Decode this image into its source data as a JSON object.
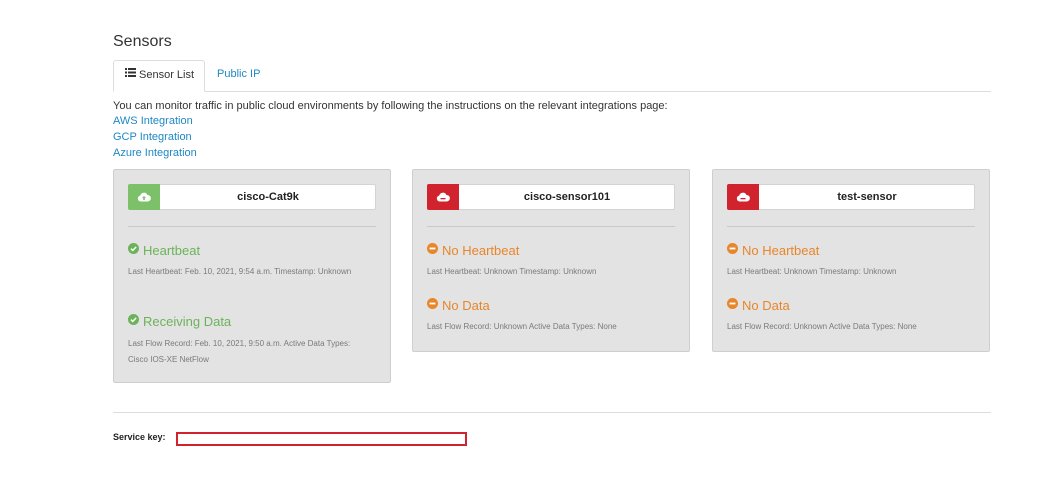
{
  "header": {
    "title": "Sensors"
  },
  "tabs": [
    {
      "label": "Sensor List",
      "icon": "list-icon",
      "active": true
    },
    {
      "label": "Public IP",
      "active": false
    }
  ],
  "intro": {
    "text": "You can monitor traffic in public cloud environments by following the instructions on the relevant integrations page:",
    "links": [
      "AWS Integration",
      "GCP Integration",
      "Azure Integration"
    ]
  },
  "sensors": [
    {
      "name": "cisco-Cat9k",
      "cloud_color": "#7cc06a",
      "heartbeat": {
        "label": "Heartbeat",
        "state": "ok",
        "detail": "Last Heartbeat: Feb. 10, 2021, 9:54 a.m. Timestamp: Unknown"
      },
      "data": {
        "label": "Receiving Data",
        "state": "ok",
        "detail": "Last Flow Record: Feb. 10, 2021, 9:50 a.m. Active Data Types: Cisco IOS-XE NetFlow"
      }
    },
    {
      "name": "cisco-sensor101",
      "cloud_color": "#d0232e",
      "heartbeat": {
        "label": "No Heartbeat",
        "state": "warn",
        "detail": "Last Heartbeat: Unknown Timestamp: Unknown"
      },
      "data": {
        "label": "No Data",
        "state": "warn",
        "detail": "Last Flow Record: Unknown Active Data Types: None"
      }
    },
    {
      "name": "test-sensor",
      "cloud_color": "#d0232e",
      "heartbeat": {
        "label": "No Heartbeat",
        "state": "warn",
        "detail": "Last Heartbeat: Unknown Timestamp: Unknown"
      },
      "data": {
        "label": "No Data",
        "state": "warn",
        "detail": "Last Flow Record: Unknown Active Data Types: None"
      }
    }
  ],
  "service_key": {
    "label": "Service key:",
    "value": ""
  },
  "colors": {
    "link": "#1e88c4",
    "ok": "#6bb35a",
    "warn": "#e8862a",
    "error": "#d0232e"
  }
}
